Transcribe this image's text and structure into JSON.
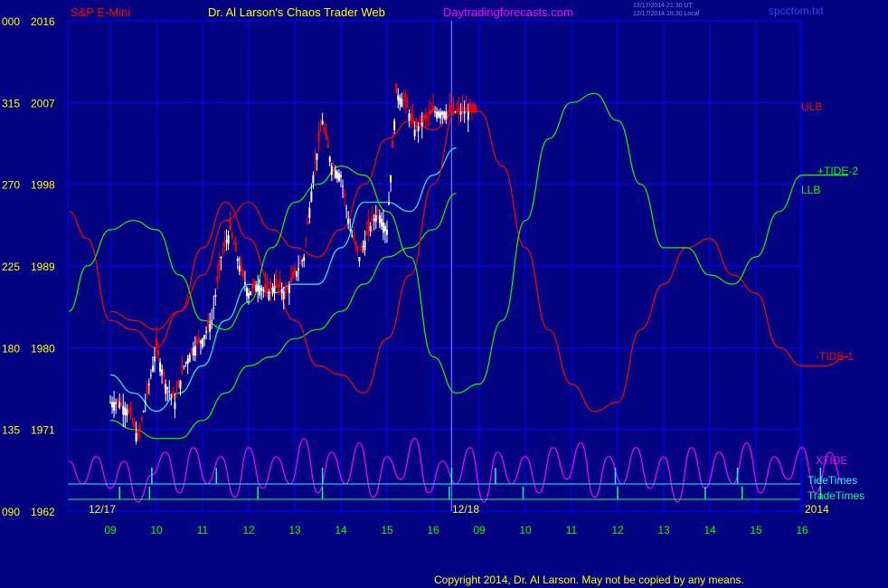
{
  "header": {
    "ticker": "S&P E-Mini",
    "title": "Dr. Al Larson's Chaos Trader Web",
    "site": "Daytradingforecasts.com",
    "time_line1": "12/17/2014 21:30 UT",
    "time_line2": "12/17/2014 16:30 Local",
    "filename": "spcctom.txt"
  },
  "footer": {
    "copyright": "Copyright 2014, Dr. Al Larson. May not be copied by any means."
  },
  "colors": {
    "background": "#000080",
    "grid": "#0000ff",
    "axis_text": "#ffff00",
    "hour_text": "#00ff00",
    "ulb": "#ff0000",
    "llb": "#00ff00",
    "tide1": "#ff0000",
    "tide2": "#00ff00",
    "xtide": "#ff00ff",
    "tidetimes": "#00ffff",
    "tradetimes": "#00ff80",
    "ma": "#00ffff",
    "candle_up": "#ffffff",
    "candle_down": "#ff0000"
  },
  "chart_data": {
    "type": "line",
    "title": "S&P E-Mini",
    "xlabel": "",
    "ylabel": "",
    "ylim": [
      1962,
      2016
    ],
    "y_ticks": [
      {
        "left": "000",
        "value": 2016
      },
      {
        "left": "315",
        "value": 2007
      },
      {
        "left": "270",
        "value": 1998
      },
      {
        "left": "225",
        "value": 1989
      },
      {
        "left": "180",
        "value": 1980
      },
      {
        "left": "135",
        "value": 1971
      },
      {
        "left": "090",
        "value": 1962
      }
    ],
    "x_hours_day1": [
      "09",
      "10",
      "11",
      "12",
      "13",
      "14",
      "15",
      "16"
    ],
    "x_hours_day2": [
      "09",
      "10",
      "11",
      "12",
      "13",
      "14",
      "15",
      "16"
    ],
    "date_labels": [
      "12/17",
      "12/18"
    ],
    "year_label": "2014",
    "series_labels": {
      "ulb": "ULB",
      "llb": "LLB",
      "tide2": "+TIDE-2",
      "tide1": "-TIDE-1",
      "xtide": "XTIDE",
      "tidetimes": "TideTimes",
      "tradetimes": "TradeTimes"
    },
    "series": [
      {
        "name": "ULB",
        "x": [
          0,
          0.5,
          1,
          1.5,
          2,
          2.5,
          3,
          3.5,
          4,
          4.5,
          5,
          5.5,
          6,
          6.5,
          7,
          7.5
        ],
        "y": [
          1984,
          1983,
          1982,
          1984,
          1988,
          1994,
          1996,
          1993,
          1991,
          1990,
          1993,
          1998,
          2003,
          2005,
          2004,
          2006
        ]
      },
      {
        "name": "LLB",
        "x": [
          0,
          0.5,
          1,
          1.5,
          2,
          2.5,
          3,
          3.5,
          4,
          4.5,
          5,
          5.5,
          6,
          6.5,
          7,
          7.5
        ],
        "y": [
          1972,
          1971,
          1970,
          1970,
          1972,
          1975,
          1978,
          1979,
          1981,
          1982,
          1984,
          1987,
          1990,
          1991,
          1993,
          1997
        ]
      },
      {
        "name": "MA",
        "x": [
          0,
          0.5,
          1,
          1.5,
          2,
          2.5,
          3,
          3.5,
          4,
          4.5,
          5,
          5.5,
          6,
          6.5,
          7,
          7.5
        ],
        "y": [
          1977,
          1975,
          1973,
          1975,
          1978,
          1983,
          1987,
          1986,
          1987,
          1987,
          1991,
          1996,
          1996,
          1995,
          1999,
          2002
        ]
      },
      {
        "name": "-TIDE-1",
        "x": [
          -0.9,
          -0.5,
          0,
          0.5,
          1,
          1.5,
          2,
          2.5,
          3,
          3.5,
          4,
          4.5,
          5,
          5.5,
          6,
          6.5,
          7,
          7.5,
          8,
          8.5,
          9,
          9.5,
          10,
          10.5,
          11,
          11.5,
          12,
          12.5,
          13,
          13.5,
          14,
          14.5,
          15,
          15.5,
          16
        ],
        "y": [
          1995,
          1992,
          1983,
          1982,
          1980,
          1984,
          1991,
          1996,
          1992,
          1987,
          1983,
          1978,
          1977,
          1975,
          1981,
          1988,
          1998,
          2006,
          2006,
          2000,
          1991,
          1982,
          1976,
          1973,
          1974,
          1982,
          1987,
          1991,
          1992,
          1988,
          1986,
          1980,
          1978,
          1978,
          1979
        ]
      },
      {
        "name": "+TIDE-2",
        "x": [
          -0.9,
          -0.5,
          0,
          0.5,
          1,
          1.5,
          2,
          2.5,
          3,
          3.5,
          4,
          4.5,
          5,
          5.5,
          6,
          6.5,
          7,
          7.5,
          8,
          8.5,
          9,
          9.5,
          10,
          10.5,
          11,
          11.5,
          12,
          12.5,
          13,
          13.5,
          14,
          14.5,
          15,
          15.5,
          16
        ],
        "y": [
          1984,
          1989,
          1993,
          1994,
          1993,
          1988,
          1983,
          1982,
          1985,
          1991,
          1996,
          1998,
          2000,
          1999,
          1995,
          1990,
          1979,
          1975,
          1976,
          1983,
          1994,
          2003,
          2007,
          2008,
          2005,
          1998,
          1991,
          1991,
          1988,
          1987,
          1990,
          1995,
          1999,
          1999,
          1999
        ]
      },
      {
        "name": "XTIDE",
        "x": [
          -0.9,
          -0.6,
          -0.3,
          0,
          0.3,
          0.6,
          0.9,
          1.2,
          1.5,
          1.8,
          2.1,
          2.4,
          2.7,
          3,
          3.3,
          3.6,
          3.9,
          4.2,
          4.5,
          4.8,
          5.1,
          5.4,
          5.7,
          6,
          6.3,
          6.6,
          6.9,
          7.2,
          7.5,
          7.8,
          8.1,
          8.4,
          8.7,
          9,
          9.3,
          9.6,
          9.9,
          10.2,
          10.5,
          10.8,
          11.1,
          11.4,
          11.7,
          12,
          12.3,
          12.6,
          12.9,
          13.2,
          13.5,
          13.8,
          14.1,
          14.4,
          14.7,
          15,
          15.3,
          15.6,
          15.9
        ],
        "y": [
          1967.5,
          1965,
          1968,
          1964.5,
          1967.5,
          1963,
          1966,
          1968.5,
          1964,
          1969,
          1965,
          1968,
          1963.5,
          1969,
          1964.5,
          1968,
          1965,
          1970,
          1964,
          1968.5,
          1965,
          1969.5,
          1963.5,
          1968,
          1965.5,
          1970,
          1964,
          1967.5,
          1965,
          1969,
          1963,
          1968.5,
          1965,
          1968,
          1964,
          1969,
          1965.5,
          1969.5,
          1963.5,
          1968,
          1965,
          1969,
          1964.5,
          1968,
          1963,
          1969,
          1964.5,
          1968.5,
          1965,
          1969.5,
          1964,
          1968,
          1965.5,
          1969,
          1964,
          1968.5,
          1965
        ]
      },
      {
        "name": "Price",
        "x": [
          0,
          0.2,
          0.4,
          0.6,
          0.8,
          1,
          1.2,
          1.4,
          1.6,
          1.8,
          2,
          2.2,
          2.4,
          2.6,
          2.8,
          3,
          3.2,
          3.4,
          3.6,
          3.8,
          4,
          4.2,
          4.4,
          4.6,
          4.8,
          5,
          5.2,
          5.4,
          5.6,
          5.8,
          6,
          6.2,
          6.4,
          6.6,
          6.8,
          7,
          7.2,
          7.4,
          7.6,
          7.8,
          8
        ],
        "y": [
          1974,
          1974,
          1973,
          1970,
          1975,
          1980,
          1976,
          1974,
          1978,
          1980,
          1981,
          1983,
          1990,
          1993,
          1989,
          1986,
          1987,
          1986,
          1987,
          1986,
          1988,
          1990,
          1999,
          2005,
          2000,
          1999,
          1993,
          1990,
          1993,
          1995,
          1993,
          2008,
          2007,
          2004,
          2005,
          2006,
          2006,
          2006,
          2006,
          2006,
          2006
        ]
      }
    ],
    "tide_times_x": [
      0.9,
      2.3,
      4.6,
      7.4,
      8.35,
      10.95,
      13.6,
      15.4
    ],
    "trade_times_x": [
      0.2,
      0.85,
      3.2,
      4.6,
      7.35,
      8.95,
      11.0,
      12.9,
      13.7,
      15.4
    ]
  }
}
